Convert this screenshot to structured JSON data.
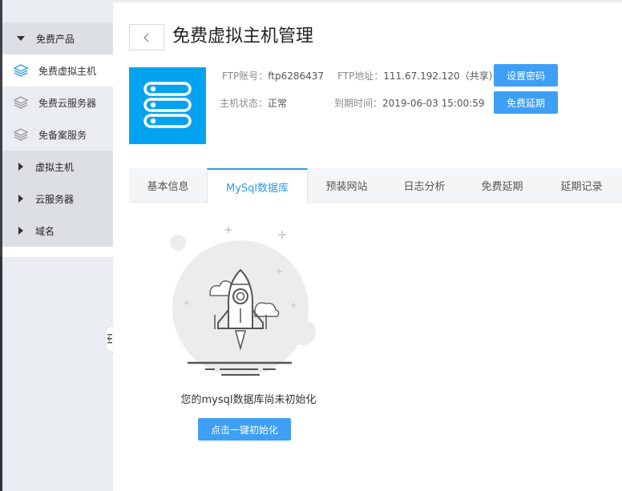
{
  "sidebar": {
    "groups": [
      {
        "label": "免费产品",
        "expanded": true
      },
      {
        "label": "虚拟主机",
        "expanded": false
      },
      {
        "label": "云服务器",
        "expanded": false
      },
      {
        "label": "域名",
        "expanded": false
      }
    ],
    "items": [
      {
        "label": "免费虚拟主机",
        "active": true
      },
      {
        "label": "免费云服务器",
        "active": false
      },
      {
        "label": "免备案服务",
        "active": false
      }
    ]
  },
  "header": {
    "title": "免费虚拟主机管理"
  },
  "server": {
    "ftp_account_label": "FTP账号：",
    "ftp_account": "ftp6286437",
    "ftp_address_label": "FTP地址：",
    "ftp_address": "111.67.192.120（共享）",
    "status_label": "主机状态：",
    "status": "正常",
    "expiry_label": "到期时间：",
    "expiry": "2019-06-03 15:00:59",
    "set_password_label": "设置密码",
    "extend_label": "免费延期"
  },
  "tabs": [
    {
      "label": "基本信息",
      "active": false
    },
    {
      "label": "MySql数据库",
      "active": true
    },
    {
      "label": "预装网站",
      "active": false
    },
    {
      "label": "日志分析",
      "active": false
    },
    {
      "label": "免费延期",
      "active": false
    },
    {
      "label": "延期记录",
      "active": false
    }
  ],
  "empty_state": {
    "message": "您的mysql数据库尚未初始化",
    "button_label": "点击一键初始化"
  },
  "colors": {
    "accent": "#3e9ff5",
    "logo_bg": "#04a3f2",
    "tab_active": "#3398e8",
    "sidebar_bg": "#e9ecf0",
    "sidebar_group_bg": "#dcdfe4"
  },
  "icons": {
    "sidebar_item": "layers-icon",
    "back": "chevron-left-icon",
    "logo": "server-stack-icon",
    "illustration": "rocket-icon"
  }
}
